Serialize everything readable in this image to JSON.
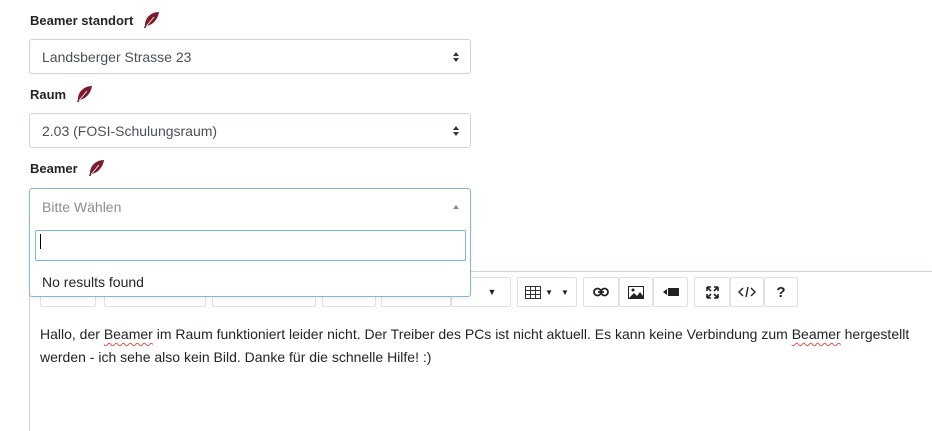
{
  "form": {
    "location": {
      "label": "Beamer standort",
      "value": "Landsberger Strasse 23"
    },
    "room": {
      "label": "Raum",
      "value": "2.03 (FOSI-Schulungsraum)"
    },
    "beamer": {
      "label": "Beamer",
      "placeholder": "Bitte Wählen"
    }
  },
  "dropdown": {
    "search_value": "",
    "no_results": "No results found"
  },
  "toolbar": {
    "help_label": "?"
  },
  "editor": {
    "line1_a": "Hallo, der ",
    "word1": "Beamer",
    "line1_b": " im Raum funktioniert leider nicht. Der Treiber des PCs ist nicht aktuell. Es kann keine Verbindung zum ",
    "word2": "Beamer",
    "line1_c": " hergestellt",
    "line2": "werden - ich sehe also kein Bild. Danke für die schnelle Hilfe! :)"
  },
  "colors": {
    "feather": "#7b1c2c",
    "focus_border": "#8ab4d8"
  },
  "icons": [
    "feather-icon",
    "sort-icon",
    "chevron-down-icon",
    "table-icon",
    "link-icon",
    "image-icon",
    "video-icon",
    "fullscreen-icon",
    "code-icon"
  ]
}
